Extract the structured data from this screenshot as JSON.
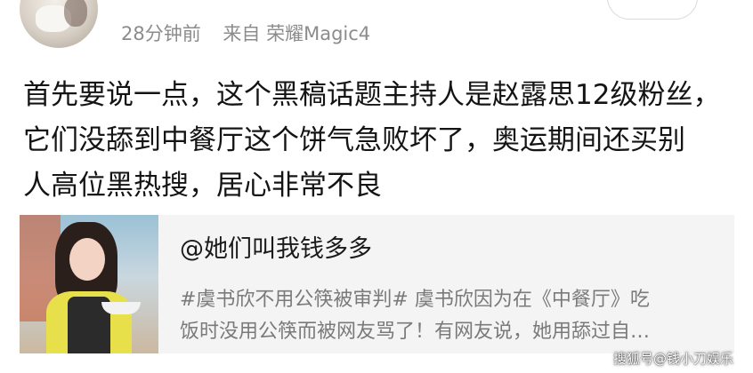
{
  "post": {
    "time": "28分钟前",
    "source": "来自 荣耀Magic4",
    "text_lines": [
      "首先要说一点，这个黑稿话题主持人是赵露思12级粉丝，",
      "它们没舔到中餐厅这个饼气急败坏了，奥运期间还买别",
      "人高位黑热搜，居心非常不良"
    ]
  },
  "card": {
    "title": "@她们叫我钱多多",
    "desc_lines": [
      "#虞书欣不用公筷被审判# 虞书欣因为在《中餐厅》吃",
      "饭时没用公筷而被网友骂了！有网友说，她用舔过自…"
    ]
  },
  "watermark": "搜狐号@钱小刀娱乐"
}
